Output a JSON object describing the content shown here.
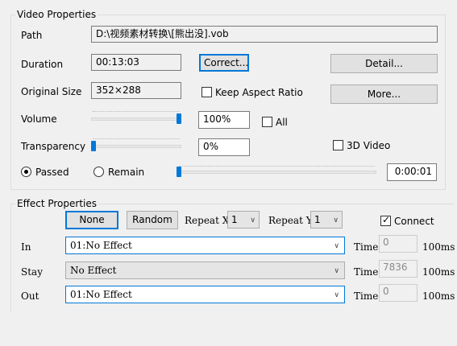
{
  "video": {
    "group_title": "Video Properties",
    "path_label": "Path",
    "path_value": "D:\\视频素材转换\\[熊出没].vob",
    "duration_label": "Duration",
    "duration_value": "00:13:03",
    "correct_button": "Correct...",
    "detail_button": "Detail...",
    "original_size_label": "Original Size",
    "original_size_value": "352×288",
    "keep_aspect_label": "Keep Aspect Ratio",
    "more_button": "More...",
    "volume_label": "Volume",
    "volume_value": "100%",
    "all_label": "All",
    "transparency_label": "Transparency",
    "transparency_value": "0%",
    "video3d_label": "3D Video",
    "passed_label": "Passed",
    "remain_label": "Remain",
    "position_value": "0:00:01"
  },
  "effect": {
    "group_title": "Effect Properties",
    "none_button": "None",
    "random_button": "Random",
    "repeat_x_label": "Repeat X",
    "repeat_x_value": "1",
    "repeat_y_label": "Repeat Y",
    "repeat_y_value": "1",
    "connect_label": "Connect",
    "rows": [
      {
        "label": "In",
        "value": "01:No Effect",
        "time_label": "Time",
        "time_value": "0",
        "unit": "100ms"
      },
      {
        "label": "Stay",
        "value": "No Effect",
        "time_label": "Time",
        "time_value": "7836",
        "unit": "100ms"
      },
      {
        "label": "Out",
        "value": "01:No Effect",
        "time_label": "Time",
        "time_value": "0",
        "unit": "100ms"
      }
    ]
  },
  "state": {
    "volume_level": 1.0,
    "transparency_level": 0.0,
    "position_level": 0.0,
    "keep_aspect_checked": false,
    "all_checked": false,
    "video3d_checked": false,
    "connect_checked": true,
    "mode_selected": "Passed"
  },
  "colors": {
    "accent": "#0078d7"
  }
}
